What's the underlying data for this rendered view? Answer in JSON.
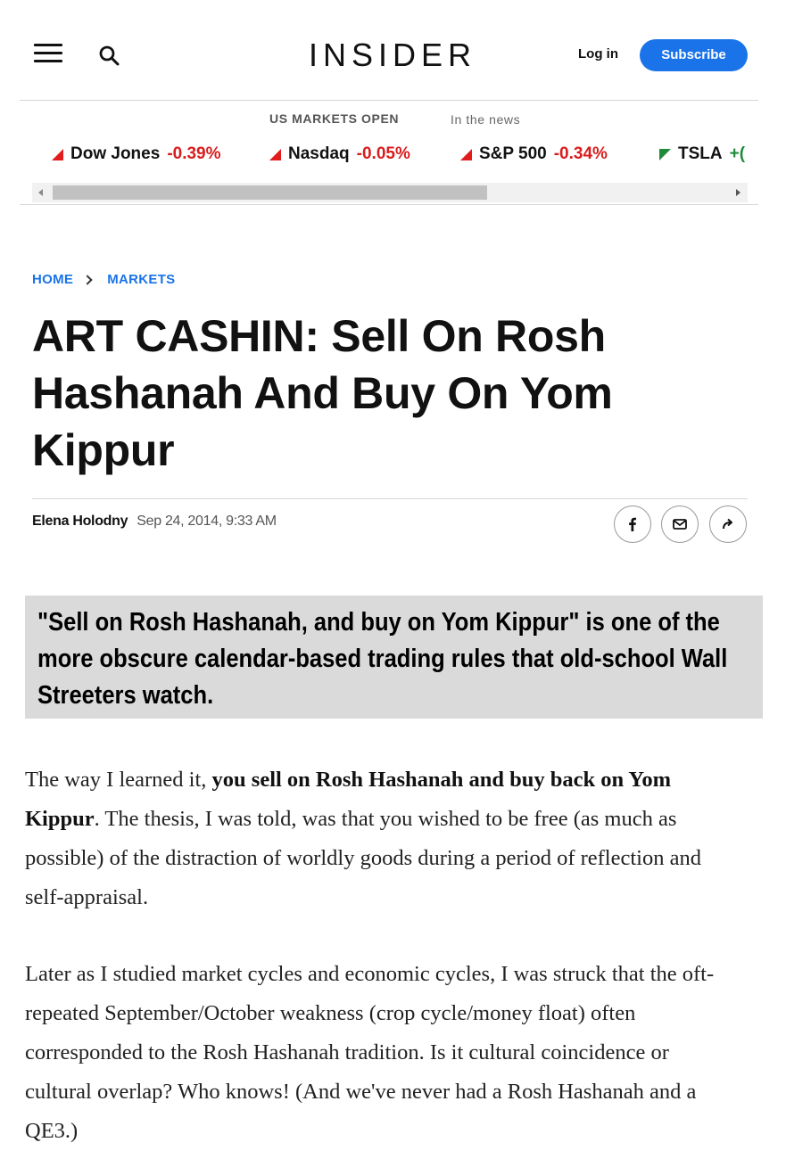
{
  "header": {
    "logo": "INSIDER",
    "login_label": "Log in",
    "subscribe_label": "Subscribe",
    "brand_color": "#1a73e8"
  },
  "ticker": {
    "status": "US MARKETS OPEN",
    "in_the_news": "In the news",
    "items": [
      {
        "name": "Dow Jones",
        "change": "-0.39%",
        "direction": "down"
      },
      {
        "name": "Nasdaq",
        "change": "-0.05%",
        "direction": "down"
      },
      {
        "name": "S&P 500",
        "change": "-0.34%",
        "direction": "down"
      },
      {
        "name": "TSLA",
        "change": "+(",
        "direction": "up"
      }
    ],
    "colors": {
      "down": "#d91c1c",
      "up": "#1f8a3a"
    }
  },
  "breadcrumb": {
    "home": "HOME",
    "section": "MARKETS"
  },
  "article": {
    "headline": "ART CASHIN: Sell On Rosh Hashanah And Buy On Yom Kippur",
    "author": "Elena Holodny",
    "date": "Sep 24, 2014, 9:33 AM",
    "share_icons": [
      "facebook-icon",
      "email-icon",
      "share-icon"
    ],
    "summary": "\"Sell on Rosh Hashanah, and buy on Yom Kippur\" is one of the more obscure calendar-based trading rules that old-school Wall Streeters watch.",
    "p1": {
      "lead": "The way I learned it, ",
      "bold": "you sell on Rosh Hashanah and buy back on Yom Kippur",
      "rest": ". The thesis, I was told, was that you wished to be free (as much as possible) of the distraction of worldly goods during a period of reflection and self-appraisal."
    },
    "p2": "Later as I studied market cycles and economic cycles, I was struck that the oft-repeated September/October weakness (crop cycle/money float) often corresponded to the Rosh Hashanah tradition. Is it cultural coincidence or cultural overlap? Who knows! (And we've never had a Rosh Hashanah and a QE3.)"
  }
}
